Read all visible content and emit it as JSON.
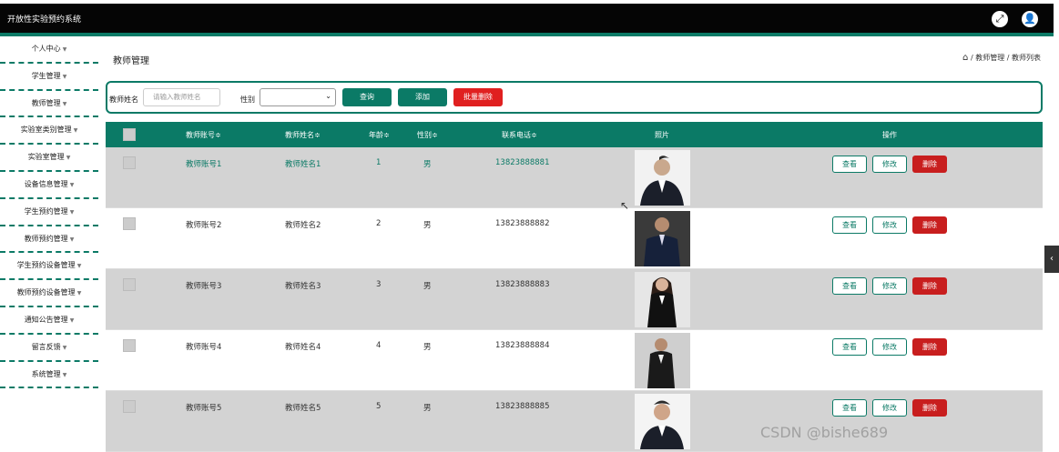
{
  "app": {
    "title": "开放性实验预约系统"
  },
  "topbar": {
    "fullscreen_icon": "fullscreen-icon",
    "user_icon": "user-icon"
  },
  "sidebar": {
    "items": [
      {
        "label": "个人中心"
      },
      {
        "label": "学生管理"
      },
      {
        "label": "教师管理"
      },
      {
        "label": "实验室类别管理"
      },
      {
        "label": "实验室管理"
      },
      {
        "label": "设备信息管理"
      },
      {
        "label": "学生预约管理"
      },
      {
        "label": "教师预约管理"
      },
      {
        "label": "学生预约设备管理"
      },
      {
        "label": "教师预约设备管理"
      },
      {
        "label": "通知公告管理"
      },
      {
        "label": "留言反馈"
      },
      {
        "label": "系统管理"
      }
    ]
  },
  "page": {
    "title": "教师管理",
    "breadcrumb": {
      "home_icon": "home-icon",
      "level1": "教师管理",
      "level2": "教师列表",
      "sep": "/"
    }
  },
  "search": {
    "name_label": "教师姓名",
    "name_placeholder": "请输入教师姓名",
    "gender_label": "性别",
    "gender_value": "",
    "query_button": "查询",
    "add_button": "添加",
    "batch_delete_button": "批量删除"
  },
  "table": {
    "headers": {
      "account": "教师账号≑",
      "name": "教师姓名≑",
      "age": "年龄≑",
      "gender": "性别≑",
      "phone": "联系电话≑",
      "photo": "照片",
      "actions": "操作"
    },
    "action_labels": {
      "view": "查看",
      "edit": "修改",
      "delete": "删除"
    },
    "rows": [
      {
        "account": "教师账号1",
        "name": "教师姓名1",
        "age": "1",
        "gender": "男",
        "phone": "13823888881"
      },
      {
        "account": "教师账号2",
        "name": "教师姓名2",
        "age": "2",
        "gender": "男",
        "phone": "13823888882"
      },
      {
        "account": "教师账号3",
        "name": "教师姓名3",
        "age": "3",
        "gender": "男",
        "phone": "13823888883"
      },
      {
        "account": "教师账号4",
        "name": "教师姓名4",
        "age": "4",
        "gender": "男",
        "phone": "13823888884"
      },
      {
        "account": "教师账号5",
        "name": "教师姓名5",
        "age": "5",
        "gender": "男",
        "phone": "13823888885"
      }
    ]
  },
  "watermark": "CSDN @bishe689",
  "colors": {
    "primary": "#0b7a66",
    "danger": "#e02020",
    "topbar": "#050505",
    "row_alt": "#d3d3d3"
  }
}
